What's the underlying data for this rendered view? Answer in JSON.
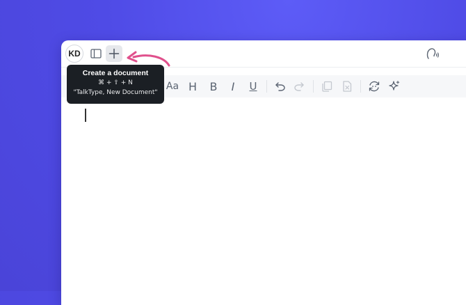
{
  "user": {
    "initials": "KD"
  },
  "toolbar": {
    "items": [
      {
        "name": "font-size-icon",
        "glyph": "Aa"
      },
      {
        "name": "heading-icon",
        "glyph": "H"
      },
      {
        "name": "bold-icon",
        "glyph": "B"
      },
      {
        "name": "italic-icon",
        "glyph": "I"
      },
      {
        "name": "underline-icon",
        "glyph": "U"
      }
    ]
  },
  "tooltip": {
    "title": "Create a document",
    "shortcut": "⌘ + ⇧ + N",
    "voice_command": "\"TalkType, New Document\""
  },
  "colors": {
    "accent_arrow": "#e0508c",
    "tooltip_bg": "#1b1f24",
    "background": "#4f4be6"
  }
}
